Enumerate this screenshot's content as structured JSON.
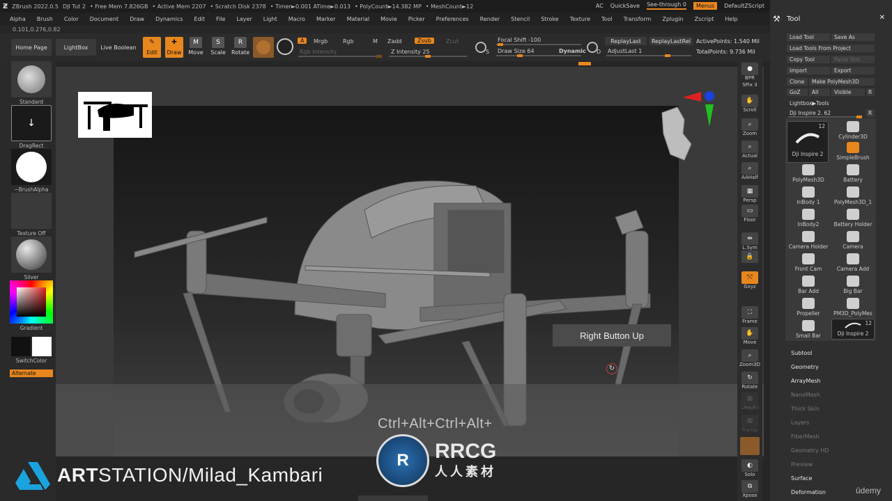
{
  "titlebar": {
    "app": "ZBrush 2022.0.5",
    "doc": "DJI Tut 2",
    "free_mem": "• Free Mem 7.826GB",
    "active_mem": "• Active Mem 2207",
    "scratch": "• Scratch Disk 2378",
    "timer": "• Timer►0.001 ATime►0.013",
    "polycount": "• PolyCount►14.382 MP",
    "meshcount": "• MeshCount►12",
    "ac": "AC",
    "quicksave": "QuickSave",
    "see_through": "See-through  0",
    "menus": "Menus",
    "script": "DefaultZScript"
  },
  "menu": [
    "Alpha",
    "Brush",
    "Color",
    "Document",
    "Draw",
    "Dynamics",
    "Edit",
    "File",
    "Layer",
    "Light",
    "Macro",
    "Marker",
    "Material",
    "Movie",
    "Picker",
    "Preferences",
    "Render",
    "Stencil",
    "Stroke",
    "Texture",
    "Tool",
    "Transform",
    "Zplugin",
    "Zscript",
    "Help"
  ],
  "coords": "0.101,0.276,0.82",
  "toolbar": {
    "home": "Home Page",
    "lightbox": "LightBox",
    "liveboolean": "Live Boolean",
    "edit": "Edit",
    "draw": "Draw",
    "move": "Move",
    "scale": "Scale",
    "rotate": "Rotate",
    "a": "A",
    "mrgb": "Mrgb",
    "rgb": "Rgb",
    "m": "M",
    "zadd": "Zadd",
    "zsub": "Zsub",
    "zcut": "Zcut",
    "rgb_intensity": "Rgb Intensity",
    "z_intensity": "Z Intensity 25",
    "focal_shift": "Focal Shift -100",
    "draw_size": "Draw Size 64",
    "dynamic": "Dynamic",
    "replaylast": "ReplayLast",
    "replaylastrel": "ReplayLastRel",
    "adjustlast": "AdjustLast  1",
    "active_points": "ActivePoints: 1.540 Mil",
    "total_points": "TotalPoints: 9.736 Mil",
    "s_label": "S",
    "d_label": "D"
  },
  "leftshelf": {
    "standard": "Standard",
    "dragrect": "DragRect",
    "brushalpha": "~BrushAlpha",
    "textureoff": "Texture Off",
    "silver": "Silver",
    "gradient": "Gradient",
    "switchcolor": "SwitchColor",
    "alternate": "Alternate"
  },
  "rightstrip": {
    "bpr": "BPR",
    "spix": "SPix 3",
    "scroll": "Scroll",
    "zoom": "Zoom",
    "actual": "Actual",
    "aahalf": "AAHalf",
    "persp": "Persp",
    "floor": "Floor",
    "lsym": "L.Sym",
    "xyz": "Gxyz",
    "frame": "Frame",
    "move": "Move",
    "zoom3d": "Zoom3D",
    "rotate": "Rotate",
    "linefill": "Line Fill",
    "polyf": "PolyF",
    "transp": "Transp",
    "solo": "Solo",
    "xpose": "Xpose"
  },
  "panel": {
    "title": "Tool",
    "load_tool": "Load Tool",
    "save_as": "Save As",
    "load_from_project": "Load Tools From Project",
    "copy_tool": "Copy Tool",
    "paste_tool": "Paste Tool",
    "import": "Import",
    "export": "Export",
    "clone": "Clone",
    "make_polymesh": "Make PolyMesh3D",
    "goz": "GoZ",
    "all": "All",
    "visible": "Visible",
    "r": "R",
    "lightbox_tools": "Lightbox▶Tools",
    "current_tool": "Dji Inspire 2. 62",
    "r2": "R",
    "tools": [
      {
        "name": "Dji Inspire 2",
        "count": "12"
      },
      {
        "name": "Cylinder3D"
      },
      {
        "name": "SimpleBrush"
      },
      {
        "name": "PolyMesh3D"
      },
      {
        "name": "Battery"
      },
      {
        "name": "InBody 1"
      },
      {
        "name": "PolyMesh3D_1"
      },
      {
        "name": "InBody2"
      },
      {
        "name": "Battery Holder"
      },
      {
        "name": "Camera Holder"
      },
      {
        "name": "Camera"
      },
      {
        "name": "Front Cam"
      },
      {
        "name": "Camera Add"
      },
      {
        "name": "Bar Add"
      },
      {
        "name": "Big Bar"
      },
      {
        "name": "Propeller"
      },
      {
        "name": "PM3D_PolyMes"
      },
      {
        "name": "Small Bar"
      },
      {
        "name": "Dji Inspire 2",
        "count": "12"
      }
    ],
    "sections": [
      {
        "label": "Subtool",
        "dim": false
      },
      {
        "label": "Geometry",
        "dim": false
      },
      {
        "label": "ArrayMesh",
        "dim": false
      },
      {
        "label": "NanoMesh",
        "dim": true
      },
      {
        "label": "Thick Skin",
        "dim": true
      },
      {
        "label": "Layers",
        "dim": true
      },
      {
        "label": "FiberMesh",
        "dim": true
      },
      {
        "label": "Geometry HD",
        "dim": true
      },
      {
        "label": "Preview",
        "dim": true
      },
      {
        "label": "Surface",
        "dim": false
      },
      {
        "label": "Deformation",
        "dim": false
      }
    ]
  },
  "overlay": {
    "tooltip": "Right Button Up",
    "shortcut": "Ctrl+Alt+Ctrl+Alt+",
    "artstation_bold": "ART",
    "artstation_rest": "STATION/Milad_Kambari",
    "rrcg": "RRCG",
    "rrcg_sub": "人人素材",
    "udemy": "ûdemy"
  },
  "colors": {
    "accent": "#e8871e",
    "panel": "#2f2f2f",
    "canvas": "#3a3a3a"
  }
}
